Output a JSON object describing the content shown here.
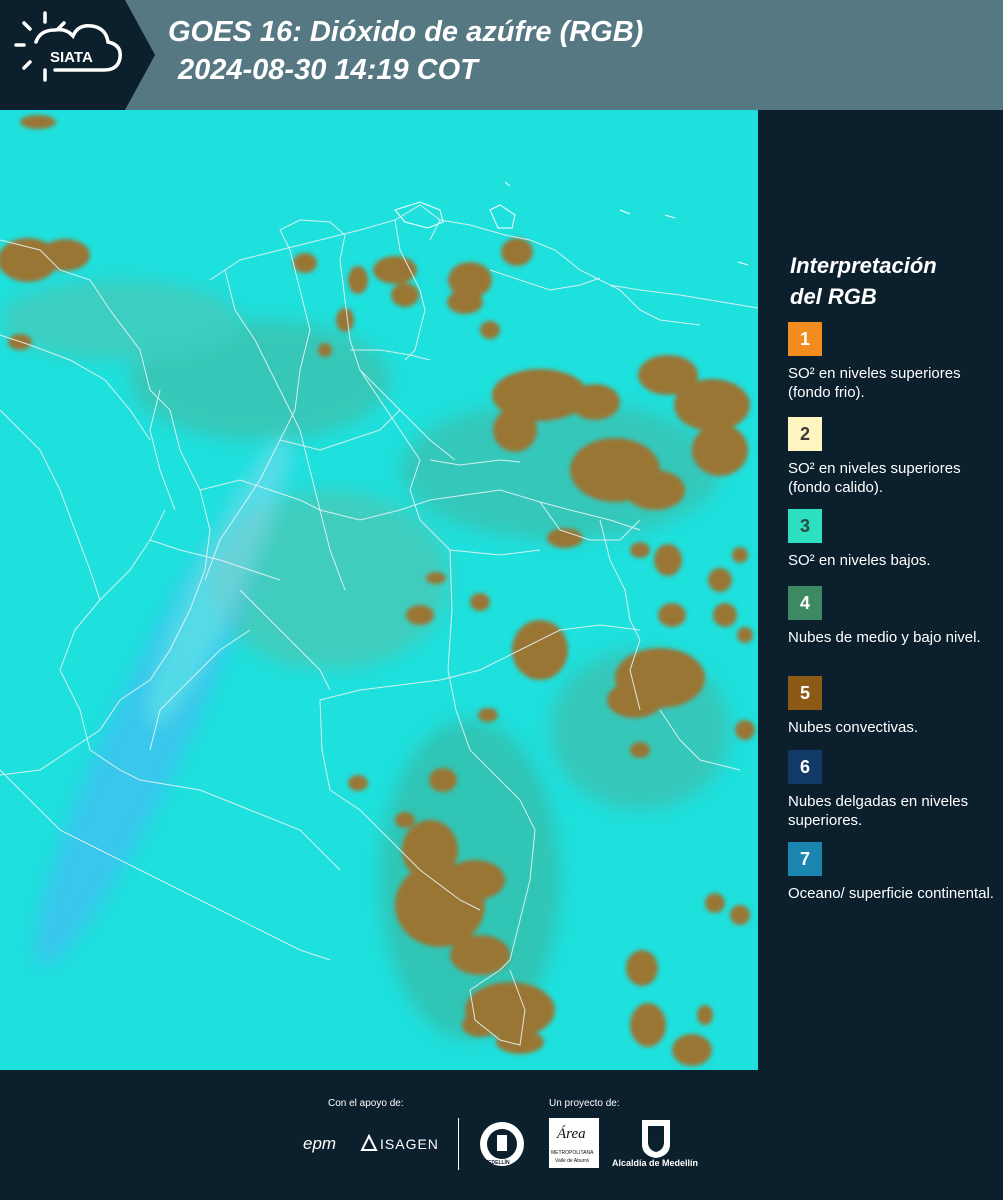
{
  "header": {
    "logo_text": "SIATA",
    "title_line1": "GOES 16: Dióxido de azúfre (RGB)",
    "title_line2": "2024-08-30 14:19 COT",
    "colors": {
      "background": "#557883",
      "logo_area": "#0c1f2d"
    }
  },
  "legend": {
    "title_line1": "Interpretación",
    "title_line2": "del RGB",
    "items": [
      {
        "number": "1",
        "label": "SO² en niveles superiores (fondo frio).",
        "color": "#f28c1c",
        "number_color": "#ffffff"
      },
      {
        "number": "2",
        "label": "SO² en niveles superiores (fondo calido).",
        "color": "#fff5c0",
        "number_color": "#3a3a3a"
      },
      {
        "number": "3",
        "label": "SO² en niveles bajos.",
        "color": "#2ce0c0",
        "number_color": "#2a4a45"
      },
      {
        "number": "4",
        "label": "Nubes de medio y bajo nivel.",
        "color": "#3d8a62",
        "number_color": "#ffffff"
      },
      {
        "number": "5",
        "label": "Nubes convectivas.",
        "color": "#8c5a14",
        "number_color": "#ffffff"
      },
      {
        "number": "6",
        "label": "Nubes delgadas en niveles superiores.",
        "color": "#123a66",
        "number_color": "#ffffff"
      },
      {
        "number": "7",
        "label": "Oceano/ superficie continental.",
        "color": "#1a86b0",
        "number_color": "#ffffff"
      }
    ]
  },
  "footer": {
    "support_caption": "Con el apoyo de:",
    "project_caption": "Un proyecto de:",
    "logos": {
      "epm": "epm",
      "isagen": "ISAGEN",
      "gobernacion_caption": "MEDELLÍN",
      "area_name": "Área",
      "area_sub": "METROPOLITANA",
      "area_sub2": "Valle de Aburrá",
      "alcaldia": "Alcaldía de Medellín"
    }
  },
  "map": {
    "colors": {
      "background": "#1ee0dd",
      "convective": "#9a7634",
      "boundary": "#e8f4f4"
    }
  }
}
